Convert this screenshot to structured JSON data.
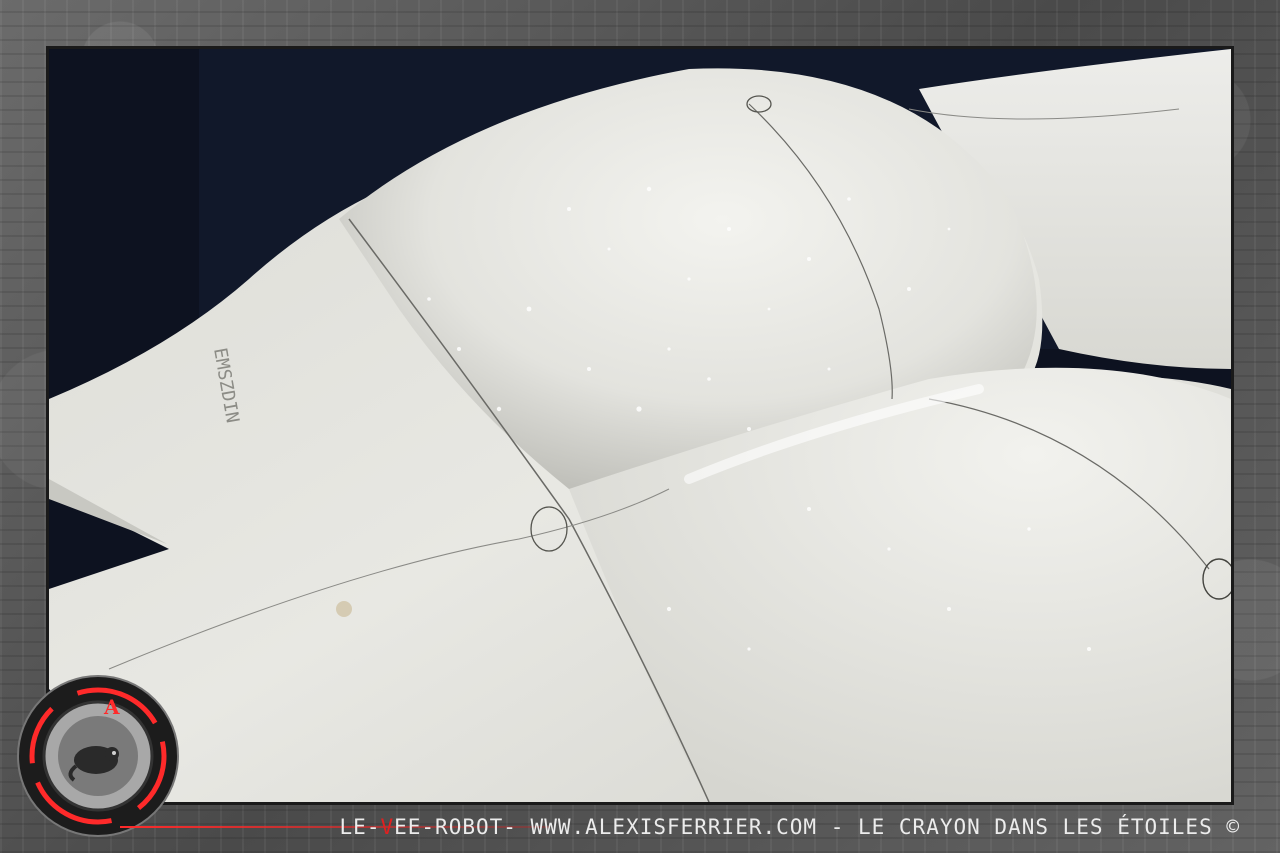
{
  "caption": {
    "part1": "LE-",
    "accent": "V",
    "part2": "EE-ROBOT- WWW.ALEXISFERRIER.COM - LE CRAYON DANS LES ÉTOILES ©"
  },
  "sculpture": {
    "engraved_text": "EMSZDIN"
  },
  "colors": {
    "background": "#0d1220",
    "foam": "#e9e9e4",
    "accent": "#e02020"
  },
  "icons": [
    "logo-badge-icon",
    "chameleon-icon"
  ]
}
